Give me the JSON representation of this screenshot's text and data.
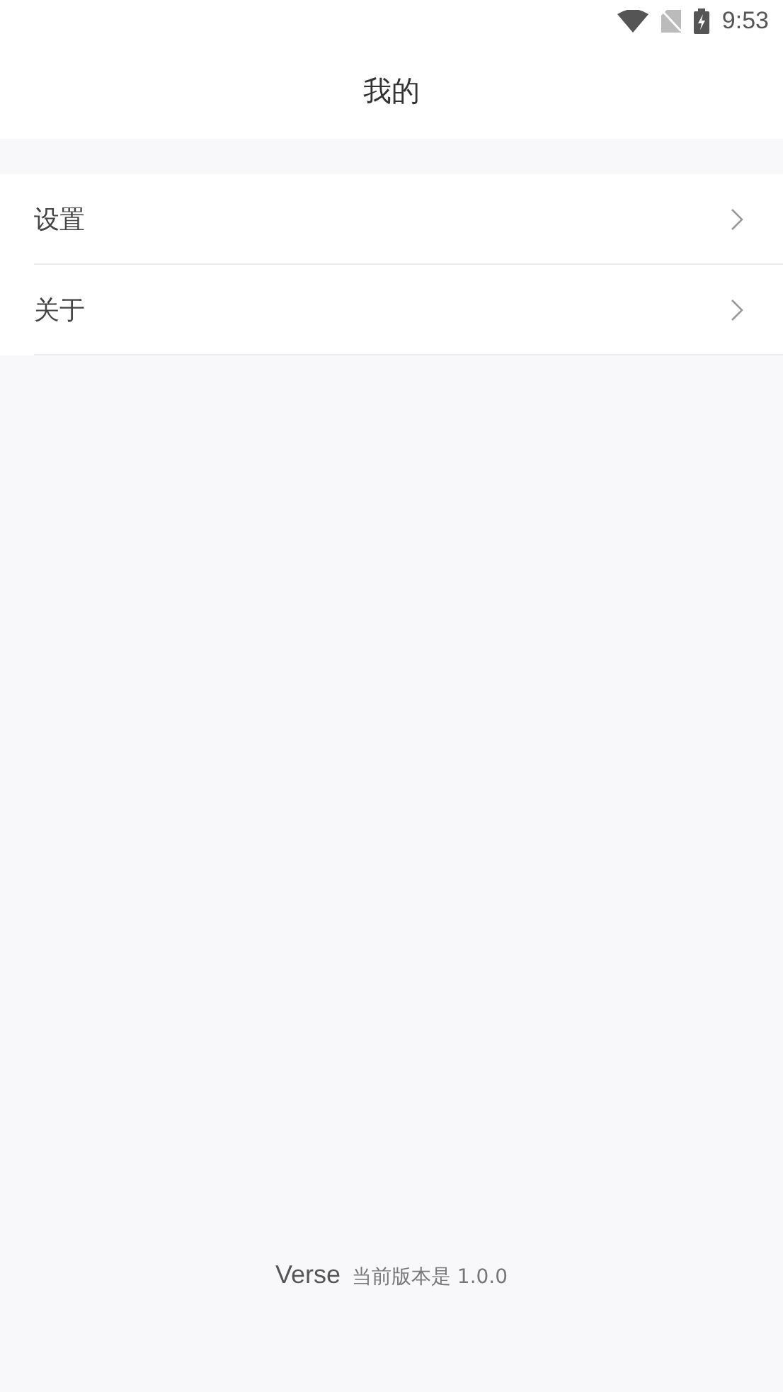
{
  "status_bar": {
    "time": "9:53"
  },
  "header": {
    "title": "我的"
  },
  "menu": [
    {
      "label": "设置"
    },
    {
      "label": "关于"
    }
  ],
  "footer": {
    "app_name": "Verse",
    "version_text": "当前版本是 1.0.0"
  }
}
